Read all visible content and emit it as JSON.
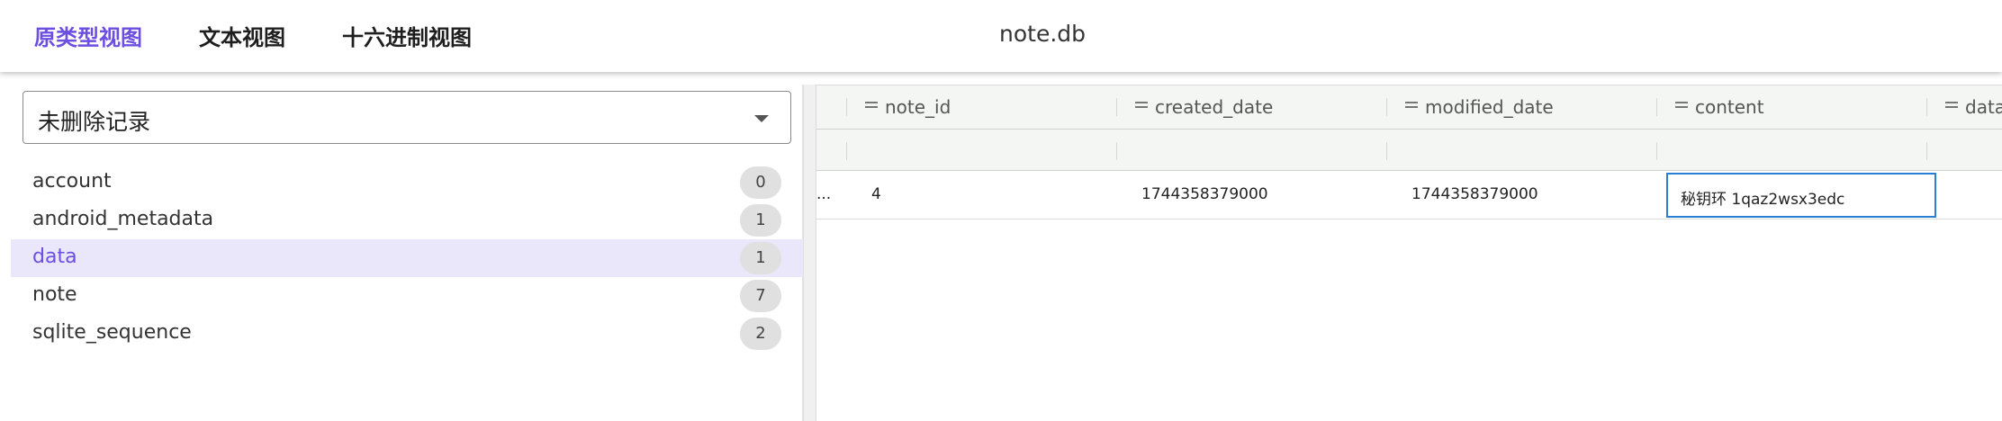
{
  "topbar": {
    "tabs": [
      {
        "label": "原类型视图",
        "active": true
      },
      {
        "label": "文本视图",
        "active": false
      },
      {
        "label": "十六进制视图",
        "active": false
      }
    ],
    "file_title": "note.db"
  },
  "sidebar": {
    "filter_select": {
      "value": "未删除记录",
      "icon": "chevron-down-icon"
    },
    "tables": [
      {
        "name": "account",
        "count": "0",
        "selected": false
      },
      {
        "name": "android_metadata",
        "count": "1",
        "selected": false
      },
      {
        "name": "data",
        "count": "1",
        "selected": true
      },
      {
        "name": "note",
        "count": "7",
        "selected": false
      },
      {
        "name": "sqlite_sequence",
        "count": "2",
        "selected": false
      }
    ]
  },
  "grid": {
    "columns": [
      {
        "name": "note_id",
        "icon": "column-menu-icon"
      },
      {
        "name": "created_date",
        "icon": "column-menu-icon"
      },
      {
        "name": "modified_date",
        "icon": "column-menu-icon"
      },
      {
        "name": "content",
        "icon": "column-menu-icon"
      },
      {
        "name": "data",
        "icon": "column-menu-icon"
      }
    ],
    "rows": [
      {
        "truncated_prefix": "...",
        "note_id": "4",
        "created_date": "1744358379000",
        "modified_date": "1744358379000",
        "content": "秘钥环 1qaz2wsx3edc",
        "data": ""
      }
    ],
    "colors": {
      "accent": "#6c4ee0",
      "focus": "#2a7fd4",
      "selected_row": "#ebe7fb"
    }
  }
}
